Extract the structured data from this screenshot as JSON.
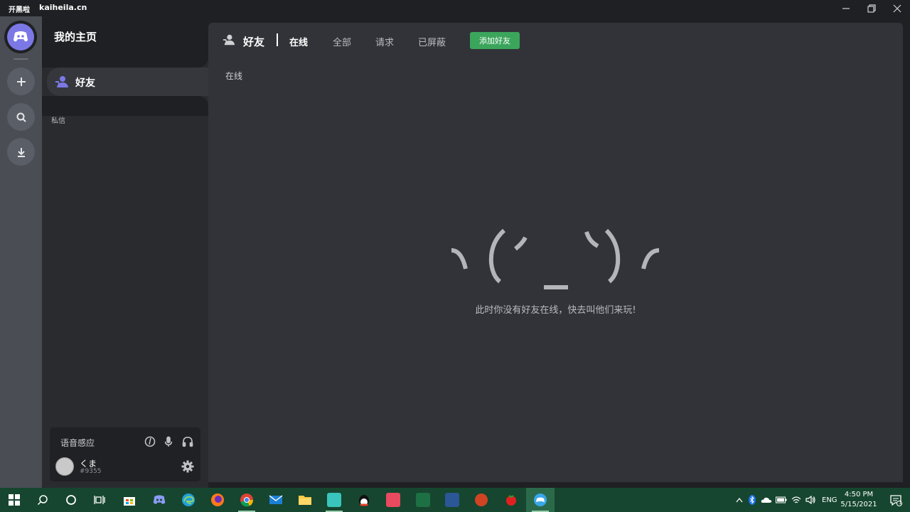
{
  "titlebar": {
    "app_name": "开黑啦",
    "app_domain": "kaiheila.cn"
  },
  "channel_panel": {
    "title": "我的主页",
    "friends_label": "好友",
    "dm_label": "私信"
  },
  "user_panel": {
    "voice_label": "语音感应",
    "username": "くま",
    "tag": "#9355"
  },
  "main": {
    "title": "好友",
    "tabs": [
      {
        "label": "在线",
        "active": true
      },
      {
        "label": "全部",
        "active": false
      },
      {
        "label": "请求",
        "active": false
      },
      {
        "label": "已屏蔽",
        "active": false
      }
    ],
    "add_friend_label": "添加好友",
    "section_label": "在线",
    "empty_message": "此时你没有好友在线，快去叫他们来玩!"
  },
  "taskbar": {
    "apps": [
      "windows-start",
      "search",
      "cortana",
      "task-view",
      "microsoft-store",
      "discord",
      "edge",
      "firefox",
      "chrome",
      "mail",
      "file-explorer",
      "miku-app",
      "qq",
      "game-app",
      "excel",
      "word",
      "powerpoint",
      "tomato-app",
      "kaiheila"
    ],
    "language": "ENG",
    "time": "4:50 PM",
    "date": "5/15/2021",
    "notification_count": "1"
  },
  "colors": {
    "accent": "#7b78e6",
    "add_friend_green": "#3ba55c",
    "taskbar": "#16462f"
  }
}
